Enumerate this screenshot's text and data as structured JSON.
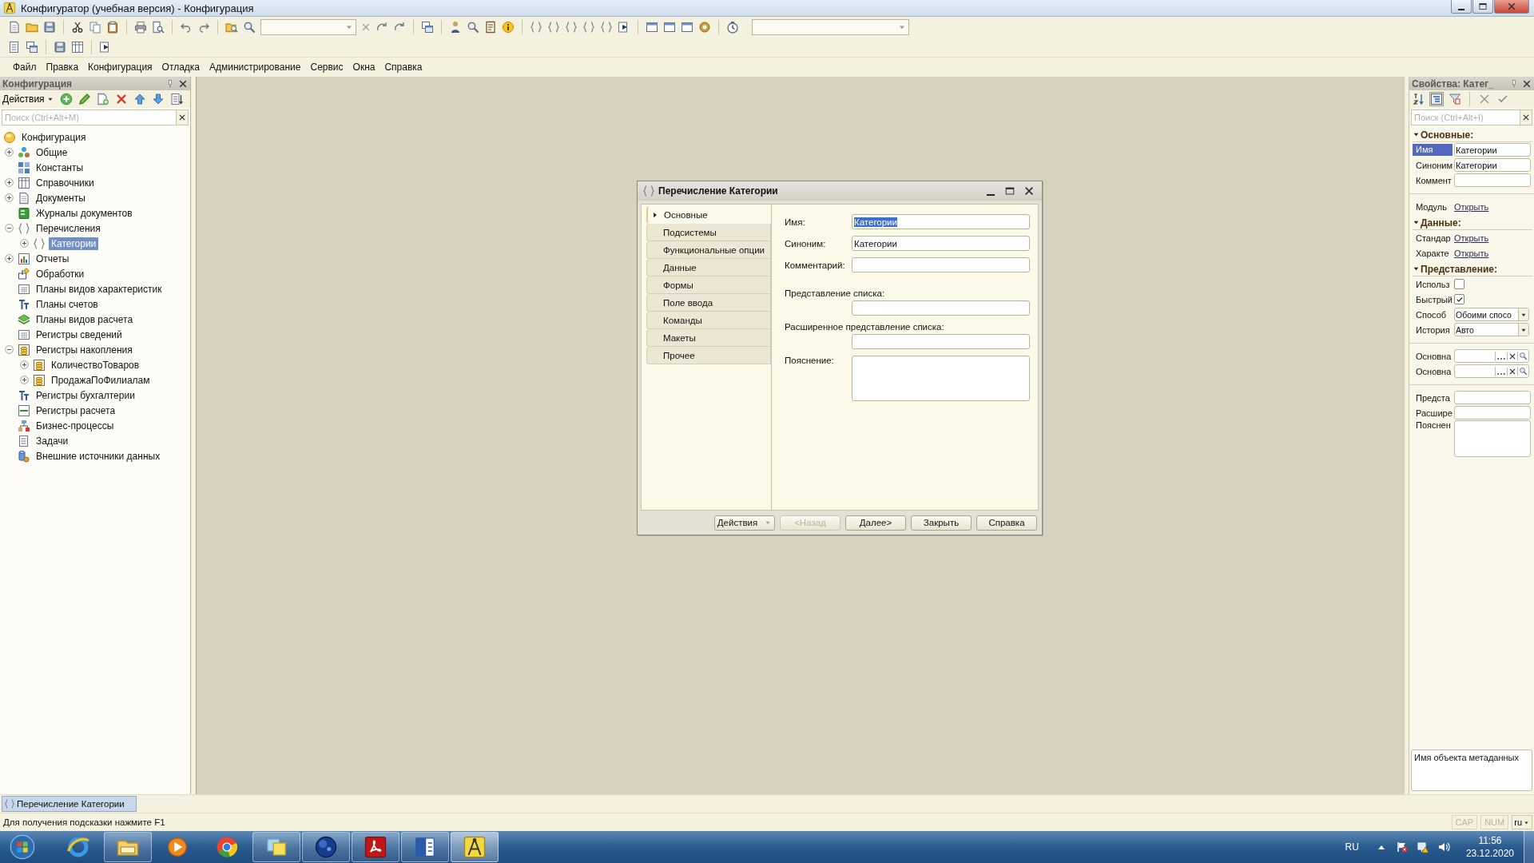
{
  "window": {
    "title": "Конфигуратор (учебная версия) - Конфигурация"
  },
  "menu": [
    "Файл",
    "Правка",
    "Конфигурация",
    "Отладка",
    "Администрирование",
    "Сервис",
    "Окна",
    "Справка"
  ],
  "config_panel": {
    "title": "Конфигурация",
    "actions": "Действия",
    "search": {
      "placeholder": "Поиск (Ctrl+Alt+M)"
    },
    "tree": {
      "label": "Конфигурация",
      "selected": false,
      "children": [
        {
          "label": "Общие",
          "expanded": false,
          "selected": false
        },
        {
          "label": "Константы",
          "selected": false
        },
        {
          "label": "Справочники",
          "expanded": false,
          "selected": false
        },
        {
          "label": "Документы",
          "expanded": false,
          "selected": false
        },
        {
          "label": "Журналы документов",
          "selected": false
        },
        {
          "label": "Перечисления",
          "expanded": true,
          "selected": false,
          "children": [
            {
              "label": "Категории",
              "expanded": false,
              "selected": true
            }
          ]
        },
        {
          "label": "Отчеты",
          "expanded": false,
          "selected": false
        },
        {
          "label": "Обработки",
          "selected": false
        },
        {
          "label": "Планы видов характеристик",
          "selected": false
        },
        {
          "label": "Планы счетов",
          "selected": false
        },
        {
          "label": "Планы видов расчета",
          "selected": false
        },
        {
          "label": "Регистры сведений",
          "selected": false
        },
        {
          "label": "Регистры накопления",
          "expanded": true,
          "selected": false,
          "children": [
            {
              "label": "КоличествоТоваров",
              "expanded": false,
              "selected": false
            },
            {
              "label": "ПродажаПоФилиалам",
              "expanded": false,
              "selected": false
            }
          ]
        },
        {
          "label": "Регистры бухгалтерии",
          "selected": false
        },
        {
          "label": "Регистры расчета",
          "selected": false
        },
        {
          "label": "Бизнес-процессы",
          "selected": false
        },
        {
          "label": "Задачи",
          "selected": false
        },
        {
          "label": "Внешние источники данных",
          "selected": false
        }
      ]
    }
  },
  "dialog": {
    "title": "Перечисление Категории",
    "tabs": [
      {
        "label": "Основные",
        "selected": true
      },
      {
        "label": "Подсистемы",
        "selected": false
      },
      {
        "label": "Функциональные опции",
        "selected": false
      },
      {
        "label": "Данные",
        "selected": false
      },
      {
        "label": "Формы",
        "selected": false
      },
      {
        "label": "Поле ввода",
        "selected": false
      },
      {
        "label": "Команды",
        "selected": false
      },
      {
        "label": "Макеты",
        "selected": false
      },
      {
        "label": "Прочее",
        "selected": false
      }
    ],
    "fields": [
      {
        "label": "Имя:",
        "kind": "inline",
        "value": "Категории",
        "text_selected": true
      },
      {
        "label": "Синоним:",
        "kind": "inline",
        "value": "Категории",
        "text_selected": false
      },
      {
        "label": "Комментарий:",
        "kind": "inline"
      },
      {
        "label": "Представление списка:",
        "kind": "stacked"
      },
      {
        "label": "Расширенное представление списка:",
        "kind": "stacked"
      },
      {
        "label": "Пояснение:",
        "kind": "textarea"
      }
    ],
    "buttons": [
      {
        "label": "Действия",
        "kind": "menu",
        "disabled": false
      },
      {
        "label": "<Назад",
        "kind": "plain",
        "disabled": true
      },
      {
        "label": "Далее>",
        "kind": "plain",
        "disabled": false
      },
      {
        "label": "Закрыть",
        "kind": "plain",
        "disabled": false
      },
      {
        "label": "Справка",
        "kind": "plain",
        "disabled": false
      }
    ]
  },
  "properties_panel": {
    "title": "Свойства: Катег_",
    "search": {
      "placeholder": "Поиск (Ctrl+Alt+I)"
    },
    "groups": [
      {
        "title": "Основные:",
        "expanded": true,
        "rows": [
          {
            "label": "Имя",
            "kind": "field",
            "value": "Категории",
            "selected": true
          },
          {
            "label": "Синоним",
            "kind": "field",
            "value": "Категории",
            "selected": false
          },
          {
            "label": "Коммент",
            "kind": "field",
            "selected": false
          }
        ]
      },
      {
        "rows": [
          {
            "label": "Модуль",
            "kind": "link",
            "value": "Открыть",
            "selected": false
          }
        ]
      },
      {
        "title": "Данные:",
        "expanded": true,
        "rows": [
          {
            "label": "Стандар",
            "kind": "link",
            "value": "Открыть",
            "selected": false
          },
          {
            "label": "Характе",
            "kind": "link",
            "value": "Открыть",
            "selected": false
          }
        ]
      },
      {
        "title": "Представление:",
        "expanded": true,
        "rows": [
          {
            "label": "Использ",
            "kind": "checkbox",
            "checked": false,
            "selected": false
          },
          {
            "label": "Быстрый",
            "kind": "checkbox",
            "checked": true,
            "selected": false
          },
          {
            "label": "Способ",
            "kind": "dropdown",
            "value": "Обоими спосо",
            "selected": false
          },
          {
            "label": "История",
            "kind": "dropdown",
            "value": "Авто",
            "selected": false
          }
        ]
      },
      {
        "rows": [
          {
            "label": "Основна",
            "kind": "choice",
            "selected": false
          },
          {
            "label": "Основна",
            "kind": "choice",
            "selected": false
          }
        ]
      },
      {
        "rows": [
          {
            "label": "Предста",
            "kind": "field",
            "selected": false
          },
          {
            "label": "Расшире",
            "kind": "field",
            "selected": false
          },
          {
            "label": "Пояснен",
            "kind": "textarea",
            "selected": false
          }
        ]
      }
    ],
    "description": "Имя объекта метаданных"
  },
  "window_tabs": [
    {
      "label": "Перечисление Категории",
      "selected": true
    }
  ],
  "status_bar": {
    "hint": "Для получения подсказки нажмите F1",
    "indicators": [
      {
        "label": "CAP",
        "on": false
      },
      {
        "label": "NUM",
        "on": false
      }
    ],
    "language": "ru"
  },
  "taskbar": {
    "apps": [
      {
        "running": false,
        "active": false
      },
      {
        "running": true,
        "active": false
      },
      {
        "running": false,
        "active": false
      },
      {
        "running": false,
        "active": false
      },
      {
        "running": true,
        "active": false
      },
      {
        "running": true,
        "active": false
      },
      {
        "running": true,
        "active": false
      },
      {
        "running": true,
        "active": false
      },
      {
        "running": true,
        "active": true
      }
    ],
    "language": "RU",
    "time": "11:56",
    "date": "23.12.2020"
  }
}
